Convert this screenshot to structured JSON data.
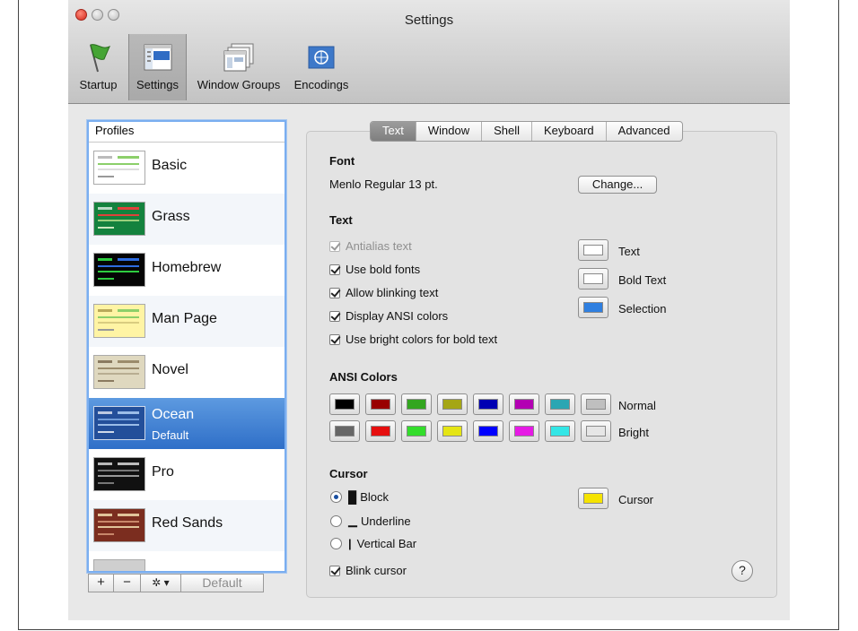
{
  "window": {
    "title": "Settings"
  },
  "toolbar": [
    {
      "label": "Startup",
      "icon": "flag-icon"
    },
    {
      "label": "Settings",
      "icon": "settings-icon"
    },
    {
      "label": "Window Groups",
      "icon": "window-groups-icon"
    },
    {
      "label": "Encodings",
      "icon": "globe-flag-icon"
    }
  ],
  "profiles": {
    "header": "Profiles",
    "items": [
      {
        "name": "Basic",
        "bg": "#ffffff"
      },
      {
        "name": "Grass",
        "bg": "#14823e"
      },
      {
        "name": "Homebrew",
        "bg": "#050505"
      },
      {
        "name": "Man Page",
        "bg": "#fff4a4"
      },
      {
        "name": "Novel",
        "bg": "#dfd8bf"
      },
      {
        "name": "Ocean",
        "subtitle": "Default",
        "bg": "#234f9a"
      },
      {
        "name": "Pro",
        "bg": "#111111"
      },
      {
        "name": "Red Sands",
        "bg": "#7b2d1f"
      }
    ],
    "buttons": {
      "add": "+",
      "remove": "−",
      "action": "✲ ▾",
      "default": "Default"
    }
  },
  "tabs": [
    "Text",
    "Window",
    "Shell",
    "Keyboard",
    "Advanced"
  ],
  "font": {
    "heading": "Font",
    "value": "Menlo Regular 13 pt.",
    "change_button": "Change..."
  },
  "text": {
    "heading": "Text",
    "options": [
      {
        "label": "Antialias text",
        "checked": true,
        "disabled": true
      },
      {
        "label": "Use bold fonts",
        "checked": true
      },
      {
        "label": "Allow blinking text",
        "checked": true
      },
      {
        "label": "Display ANSI colors",
        "checked": true
      },
      {
        "label": "Use bright colors for bold text",
        "checked": true
      }
    ],
    "color_wells": [
      {
        "label": "Text",
        "color": "#ffffff"
      },
      {
        "label": "Bold Text",
        "color": "#ffffff"
      },
      {
        "label": "Selection",
        "color": "#2f7fe0"
      }
    ]
  },
  "ansi": {
    "heading": "ANSI Colors",
    "normal_label": "Normal",
    "bright_label": "Bright",
    "normal": [
      "#000000",
      "#990000",
      "#33a61f",
      "#a5a615",
      "#0000b3",
      "#b300b3",
      "#2ba6b3",
      "#bfbfbf"
    ],
    "bright": [
      "#666666",
      "#e60f0f",
      "#33dd2b",
      "#e5e514",
      "#0000ff",
      "#e61ae5",
      "#33e6e6",
      "#e6e6e6"
    ]
  },
  "cursor": {
    "heading": "Cursor",
    "options": [
      {
        "glyph": "█",
        "label": "Block",
        "selected": true
      },
      {
        "glyph": "▁",
        "label": "Underline",
        "selected": false
      },
      {
        "glyph": "|",
        "label": "Vertical Bar",
        "selected": false
      }
    ],
    "blink_label": "Blink cursor",
    "well_label": "Cursor",
    "well_color": "#f5e300"
  },
  "help": "?"
}
